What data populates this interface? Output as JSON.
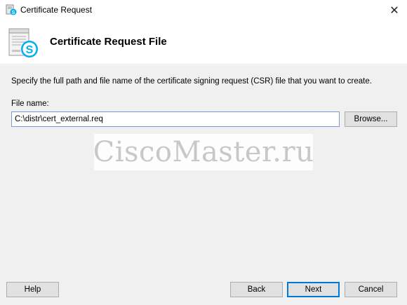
{
  "window": {
    "title": "Certificate Request",
    "close_glyph": "✕"
  },
  "header": {
    "title": "Certificate Request File",
    "icon": "skype-server-document-icon"
  },
  "main": {
    "instruction": "Specify the full path and file name of the certificate signing request (CSR) file that you want to create.",
    "file_label": "File name:",
    "file_value": "C:\\distr\\cert_external.req",
    "browse_label": "Browse..."
  },
  "footer": {
    "help_label": "Help",
    "back_label": "Back",
    "next_label": "Next",
    "cancel_label": "Cancel"
  },
  "watermark": {
    "text": "CiscoMaster.ru"
  },
  "colors": {
    "accent": "#0078d7",
    "skype_blue": "#00aff0",
    "body_bg": "#f0f0f0"
  }
}
